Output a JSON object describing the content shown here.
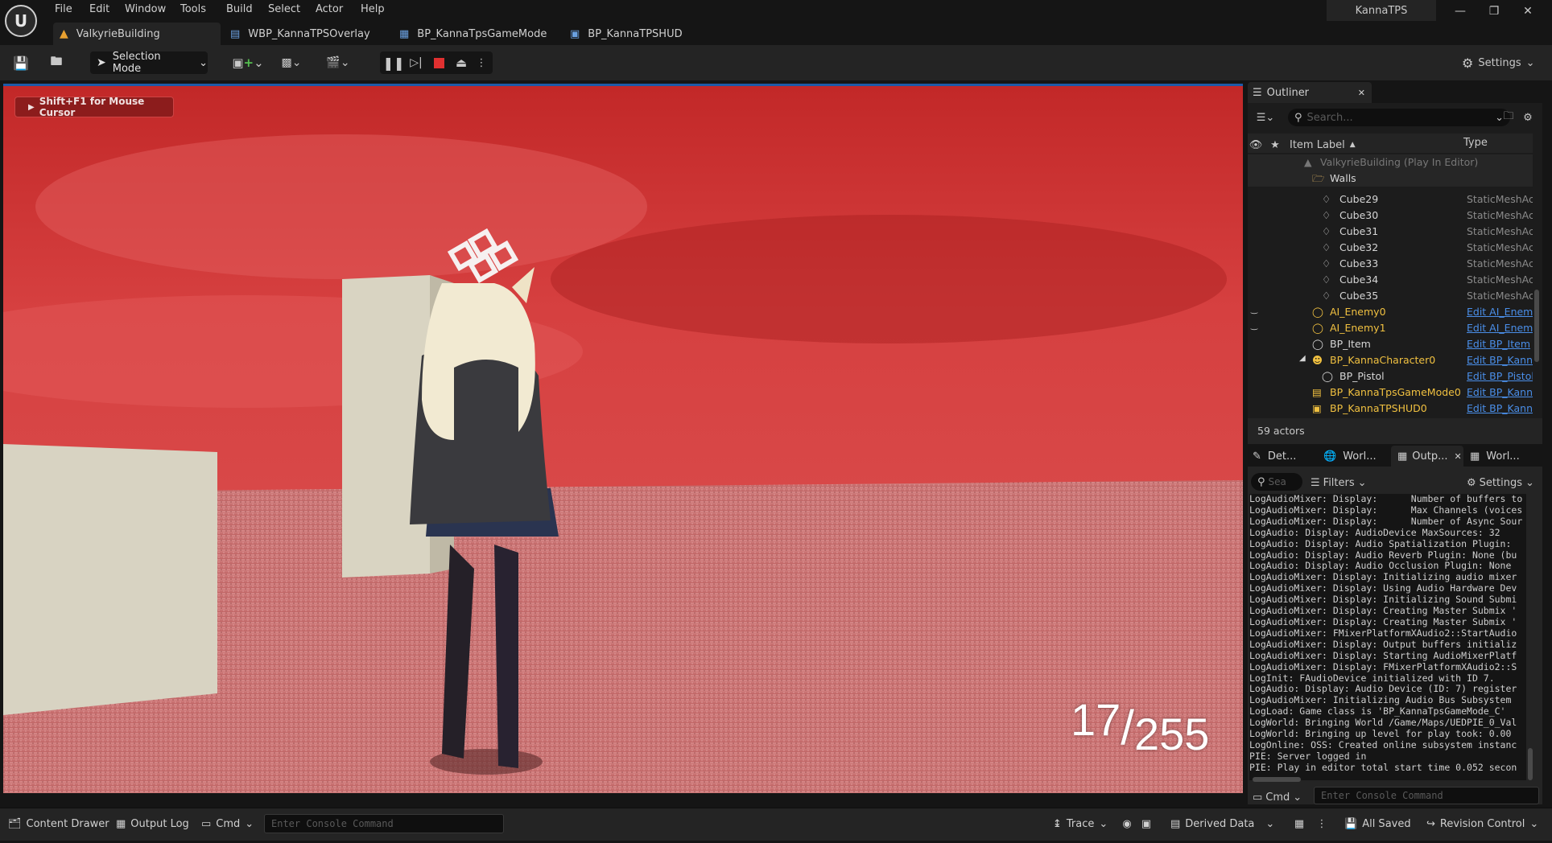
{
  "menu": [
    "File",
    "Edit",
    "Window",
    "Tools",
    "Build",
    "Select",
    "Actor",
    "Help"
  ],
  "project_name": "KannaTPS",
  "tabs": [
    {
      "label": "ValkyrieBuilding",
      "active": true
    },
    {
      "label": "WBP_KannaTPSOverlay"
    },
    {
      "label": "BP_KannaTpsGameMode"
    },
    {
      "label": "BP_KannaTPSHUD"
    }
  ],
  "toolbar": {
    "mode_label": "Selection Mode",
    "settings_label": "Settings"
  },
  "viewport": {
    "cursor_hint": "Shift+F1 for Mouse Cursor",
    "ammo_current": "17",
    "ammo_separator": "/",
    "ammo_total": "255"
  },
  "outliner": {
    "tab_label": "Outliner",
    "search_placeholder": "Search...",
    "col_item_label": "Item Label",
    "col_type": "Type",
    "root": "ValkyrieBuilding (Play In Editor)",
    "folder": "Walls",
    "items": [
      {
        "label": "Cube29",
        "type": "StaticMeshAc"
      },
      {
        "label": "Cube30",
        "type": "StaticMeshAc"
      },
      {
        "label": "Cube31",
        "type": "StaticMeshAc"
      },
      {
        "label": "Cube32",
        "type": "StaticMeshAc"
      },
      {
        "label": "Cube33",
        "type": "StaticMeshAc"
      },
      {
        "label": "Cube34",
        "type": "StaticMeshAc"
      },
      {
        "label": "Cube35",
        "type": "StaticMeshAc"
      },
      {
        "label": "AI_Enemy0",
        "type": "Edit AI_Enemy"
      },
      {
        "label": "AI_Enemy1",
        "type": "Edit AI_Enemy"
      },
      {
        "label": "BP_Item",
        "type": "Edit BP_Item"
      },
      {
        "label": "BP_KannaCharacter0",
        "type": "Edit BP_Kanna"
      },
      {
        "label": "BP_Pistol",
        "type": "Edit BP_Pistol"
      },
      {
        "label": "BP_KannaTpsGameMode0",
        "type": "Edit BP_Kanna"
      },
      {
        "label": "BP_KannaTPSHUD0",
        "type": "Edit BP_Kanna"
      }
    ],
    "actor_count": "59 actors"
  },
  "lower_tabs": [
    "Det...",
    "Worl...",
    "Outp...",
    "Worl..."
  ],
  "output_log": {
    "search_placeholder": "Sea",
    "filters_label": "Filters",
    "settings_label": "Settings",
    "lines": [
      "LogAudioMixer: Display:      Number of buffers to",
      "LogAudioMixer: Display:      Max Channels (voices",
      "LogAudioMixer: Display:      Number of Async Sour",
      "LogAudio: Display: AudioDevice MaxSources: 32",
      "LogAudio: Display: Audio Spatialization Plugin:",
      "LogAudio: Display: Audio Reverb Plugin: None (bu",
      "LogAudio: Display: Audio Occlusion Plugin: None",
      "LogAudioMixer: Display: Initializing audio mixer",
      "LogAudioMixer: Display: Using Audio Hardware Dev",
      "LogAudioMixer: Display: Initializing Sound Submi",
      "LogAudioMixer: Display: Creating Master Submix '",
      "LogAudioMixer: Display: Creating Master Submix '",
      "LogAudioMixer: FMixerPlatformXAudio2::StartAudio",
      "LogAudioMixer: Display: Output buffers initializ",
      "LogAudioMixer: Display: Starting AudioMixerPlatf",
      "LogAudioMixer: Display: FMixerPlatformXAudio2::S",
      "LogInit: FAudioDevice initialized with ID 7.",
      "LogAudio: Display: Audio Device (ID: 7) register",
      "LogAudioMixer: Initializing Audio Bus Subsystem",
      "LogLoad: Game class is 'BP_KannaTpsGameMode_C'",
      "LogWorld: Bringing World /Game/Maps/UEDPIE_0_Val",
      "LogWorld: Bringing up level for play took: 0.00",
      "LogOnline: OSS: Created online subsystem instanc",
      "PIE: Server logged in",
      "PIE: Play in editor total start time 0.052 secon"
    ],
    "cmd_label": "Cmd",
    "console_placeholder": "Enter Console Command"
  },
  "statusbar": {
    "content_drawer": "Content Drawer",
    "output_log": "Output Log",
    "cmd": "Cmd",
    "console_placeholder": "Enter Console Command",
    "trace": "Trace",
    "derived_data": "Derived Data",
    "all_saved": "All Saved",
    "revision_control": "Revision Control"
  }
}
